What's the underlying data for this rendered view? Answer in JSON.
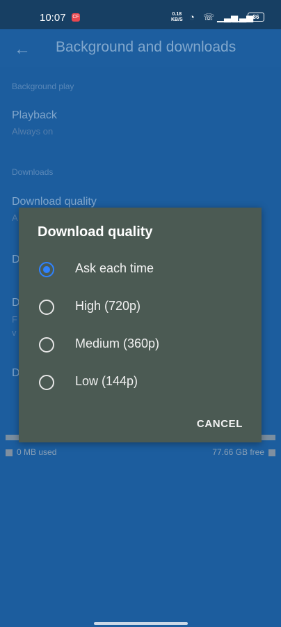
{
  "status_bar": {
    "time": "10:07",
    "rec_badge": "CF",
    "net_speed_top": "0.18",
    "net_speed_unit": "KB/S",
    "battery": "86"
  },
  "app_bar": {
    "title": "Background and downloads"
  },
  "settings": {
    "sections": [
      {
        "header": "Background play",
        "items": [
          {
            "title": "Playback",
            "subtitle": "Always on"
          }
        ]
      },
      {
        "header": "Downloads",
        "items": [
          {
            "title": "Download quality",
            "subtitle": "A"
          }
        ]
      }
    ],
    "partial_items": [
      "D",
      "D",
      "F",
      "v",
      "D"
    ],
    "storage": {
      "used": "0 MB used",
      "free": "77.66 GB free"
    }
  },
  "dialog": {
    "title": "Download quality",
    "options": [
      {
        "label": "Ask each time",
        "selected": true
      },
      {
        "label": "High (720p)",
        "selected": false
      },
      {
        "label": "Medium (360p)",
        "selected": false
      },
      {
        "label": "Low (144p)",
        "selected": false
      }
    ],
    "cancel_label": "CANCEL"
  },
  "colors": {
    "accent": "#2f82ff",
    "dialog_bg": "#4b5a53",
    "app_bg": "#1c5d9e"
  }
}
